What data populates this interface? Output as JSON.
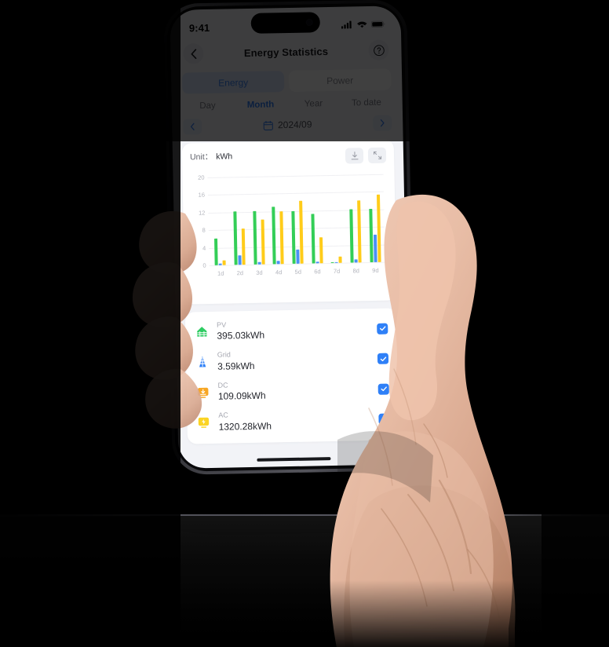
{
  "status_bar": {
    "time": "9:41",
    "cellular_icon": "signal-bars-icon",
    "wifi_icon": "wifi-icon",
    "battery_icon": "battery-icon"
  },
  "header": {
    "back_icon": "chevron-left-icon",
    "title": "Energy Statistics",
    "help_icon": "question-mark-circle-icon"
  },
  "segmented_control": {
    "items": [
      {
        "label": "Energy",
        "active": true
      },
      {
        "label": "Power",
        "active": false
      }
    ]
  },
  "period_tabs": {
    "items": [
      {
        "label": "Day",
        "active": false
      },
      {
        "label": "Month",
        "active": true
      },
      {
        "label": "Year",
        "active": false
      },
      {
        "label": "To date",
        "active": false
      }
    ]
  },
  "date_selector": {
    "prev_icon": "chevron-left-icon",
    "calendar_icon": "calendar-icon",
    "value": "2024/09",
    "next_icon": "chevron-right-icon"
  },
  "chart_card": {
    "unit_prefix": "Unit：",
    "unit_value": "kWh",
    "download_icon": "download-icon",
    "expand_icon": "fullscreen-expand-icon"
  },
  "legend": {
    "rows": [
      {
        "name": "PV",
        "value": "395.03kWh",
        "icon": "solar-panel-icon",
        "color": "#2ECC62",
        "checked": true
      },
      {
        "name": "Grid",
        "value": "3.59kWh",
        "icon": "grid-tower-icon",
        "color": "#2F80F7",
        "checked": true
      },
      {
        "name": "DC",
        "value": "109.09kWh",
        "icon": "dc-inverter-icon",
        "color": "#F7A623",
        "checked": true
      },
      {
        "name": "AC",
        "value": "1320.28kWh",
        "icon": "ac-inverter-icon",
        "color": "#FBD424",
        "checked": true
      }
    ],
    "check_icon": "check-icon"
  },
  "colors": {
    "accent_blue": "#2F80F7",
    "series_green": "#34CE57",
    "series_blue": "#4A90F5",
    "series_yellow": "#FFCC1A",
    "screen_bg": "#F2F3F7",
    "card_bg": "#FFFFFF"
  },
  "chart_data": {
    "type": "bar",
    "title": "",
    "xlabel": "",
    "ylabel": "kWh",
    "ylim": [
      0,
      20
    ],
    "yticks": [
      0,
      4,
      8,
      12,
      16,
      20
    ],
    "grid": true,
    "legend_position": "below-chart",
    "categories": [
      "1d",
      "2d",
      "3d",
      "4d",
      "5d",
      "6d",
      "7d",
      "8d",
      "9d"
    ],
    "series": [
      {
        "name": "PV",
        "color": "#34CE57",
        "values": [
          6.0,
          12.1,
          12.1,
          13.1,
          11.9,
          11.3,
          0.2,
          12.2,
          12.1
        ]
      },
      {
        "name": "Grid",
        "color": "#4A90F5",
        "values": [
          0.3,
          2.1,
          0.6,
          0.8,
          3.3,
          0.4,
          0.1,
          0.7,
          6.3
        ]
      },
      {
        "name": "AC",
        "color": "#FFCC1A",
        "values": [
          1.0,
          8.3,
          10.1,
          11.9,
          14.2,
          5.9,
          1.5,
          14.1,
          15.3
        ]
      }
    ],
    "extra_series_note": "a thin yellow sliver at baseline in several groups represents DC near 0.1"
  }
}
